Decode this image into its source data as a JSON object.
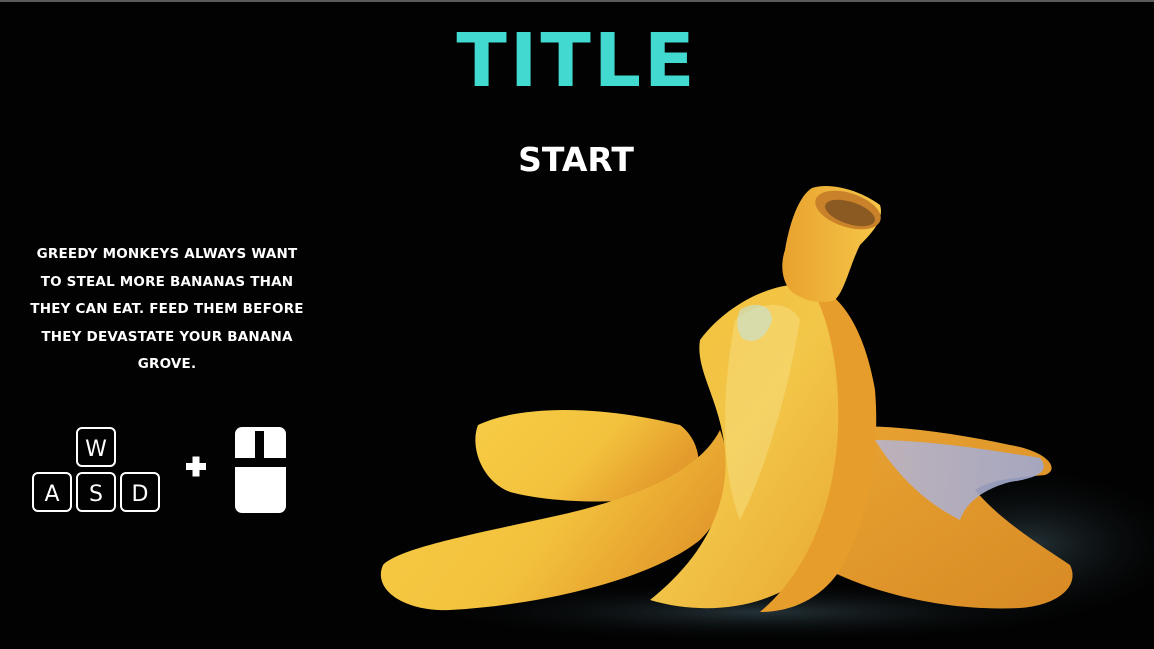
{
  "title": "TITLE",
  "start_label": "START",
  "description": "GREEDY MONKEYS ALWAYS WANT TO STEAL MORE BANANAS THAN THEY CAN EAT. FEED THEM BEFORE THEY DEVASTATE YOUR BANANA GROVE.",
  "controls": {
    "keys": [
      "W",
      "A",
      "S",
      "D"
    ],
    "plus": "+",
    "mouse_icon": "mouse-icon"
  },
  "colors": {
    "background": "#020202",
    "title": "#41d9d0",
    "text": "#ffffff",
    "banana": "#f0b53a"
  }
}
